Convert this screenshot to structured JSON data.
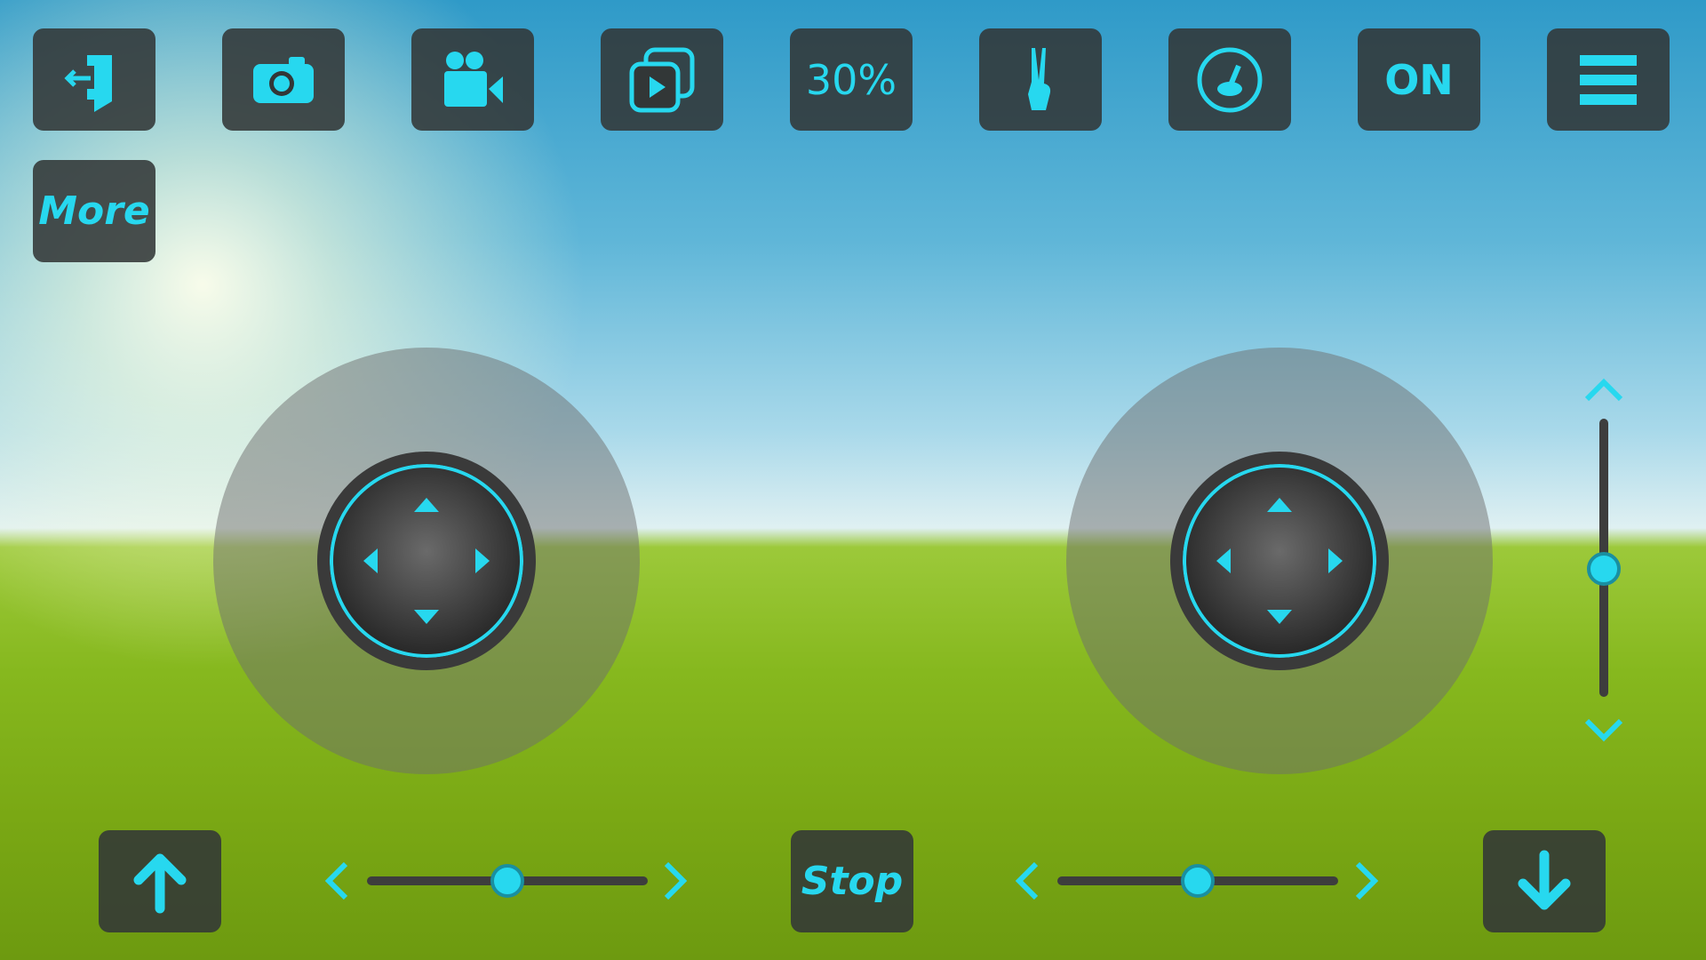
{
  "toolbar": {
    "items": [
      {
        "name": "exit-button",
        "icon": "exit-icon"
      },
      {
        "name": "photo-button",
        "icon": "camera-icon"
      },
      {
        "name": "video-button",
        "icon": "video-camera-icon"
      },
      {
        "name": "playback-button",
        "icon": "media-gallery-icon"
      },
      {
        "name": "speed-button",
        "label": "30%"
      },
      {
        "name": "gesture-button",
        "icon": "peace-hand-icon"
      },
      {
        "name": "calibrate-button",
        "icon": "gyro-calibrate-icon"
      },
      {
        "name": "power-toggle",
        "label": "ON"
      },
      {
        "name": "menu-button",
        "icon": "hamburger-menu-icon"
      }
    ],
    "more_label": "More"
  },
  "bottom": {
    "takeoff_icon": "arrow-up-icon",
    "stop_label": "Stop",
    "land_icon": "arrow-down-icon"
  },
  "controls": {
    "left_trim": 0.5,
    "right_trim": 0.5,
    "vertical_trim": 0.46
  },
  "colors": {
    "accent": "#27d8ef",
    "button_bg": "#323737"
  }
}
